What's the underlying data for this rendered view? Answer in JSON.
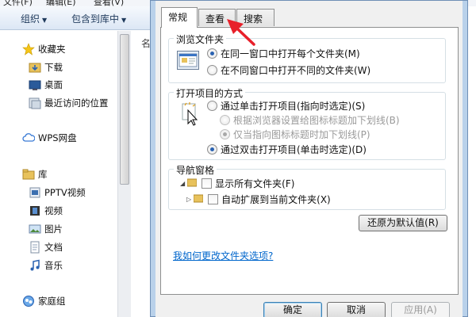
{
  "explorer": {
    "menu": [
      "文件(F)",
      "编辑(E)",
      "查看(V)"
    ],
    "toolbar": {
      "organize": "组织",
      "include_in_library": "包含到库中"
    },
    "column_header_fragment": "名",
    "sidebar": {
      "favorites": {
        "label": "收藏夹",
        "items": [
          "下载",
          "桌面",
          "最近访问的位置"
        ]
      },
      "wps": "WPS网盘",
      "library": {
        "label": "库",
        "items": [
          "PPTV视频",
          "视频",
          "图片",
          "文档",
          "音乐"
        ]
      },
      "homegroup": "家庭组"
    }
  },
  "dialog": {
    "tabs": [
      "常规",
      "查看",
      "搜索"
    ],
    "active_tab": "常规",
    "browse_group": {
      "title": "浏览文件夹",
      "options": [
        "在同一窗口中打开每个文件夹(M)",
        "在不同窗口中打开不同的文件夹(W)"
      ],
      "selected": 0
    },
    "click_group": {
      "title": "打开项目的方式",
      "single_click": "通过单击打开项目(指向时选定)(S)",
      "sub_options": [
        "根据浏览器设置给图标标题加下划线(B)",
        "仅当指向图标标题时加下划线(P)"
      ],
      "double_click": "通过双击打开项目(单击时选定)(D)",
      "selected": "double_click"
    },
    "nav_group": {
      "title": "导航窗格",
      "show_all_folders": "显示所有文件夹(F)",
      "auto_expand": "自动扩展到当前文件夹(X)"
    },
    "restore_defaults": "还原为默认值(R)",
    "help_link": "我如何更改文件夹选项?",
    "buttons": {
      "ok": "确定",
      "cancel": "取消",
      "apply": "应用(A)"
    }
  },
  "colors": {
    "accent_link": "#0066cc",
    "annotation_arrow": "#e8202a"
  }
}
